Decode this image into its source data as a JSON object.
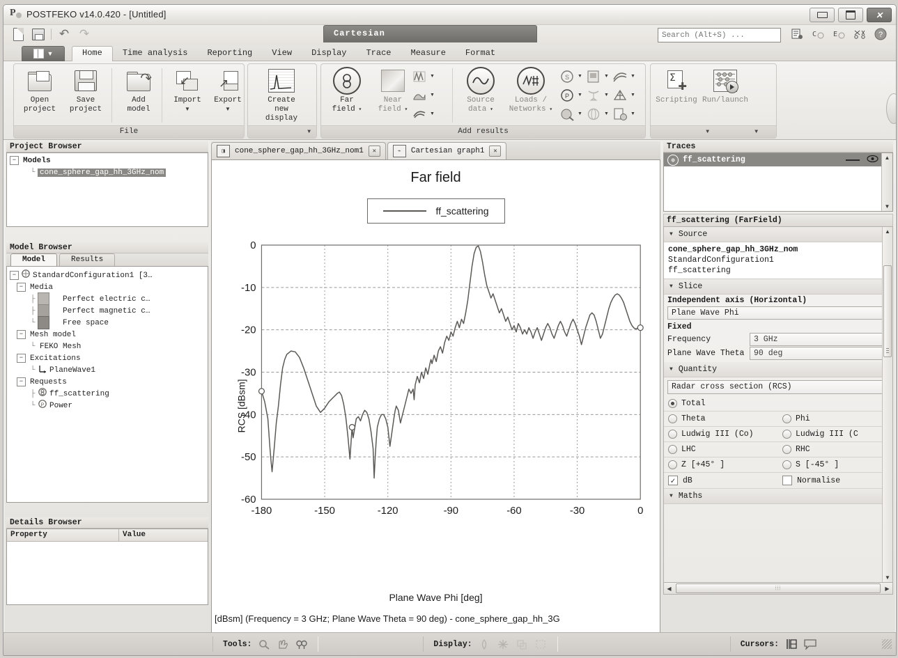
{
  "window": {
    "title": "POSTFEKO v14.0.420 - [Untitled]",
    "app_icon": "postfeko-icon",
    "minimize": "minimize-icon",
    "maximize": "maximize-icon",
    "close": "close-icon"
  },
  "quick_access": {
    "new_label": "new-document-icon",
    "save_label": "save-icon",
    "undo_label": "undo-icon",
    "redo_label": "redo-icon"
  },
  "search": {
    "placeholder": "Search (Alt+S) ...",
    "value": ""
  },
  "help_icons": [
    "notes-icon",
    "cadfeko-icon",
    "editfeko-icon",
    "feko-icon",
    "help-icon"
  ],
  "ribbon": {
    "contextual_group": "Cartesian",
    "app_menu": "application-menu",
    "tabs": [
      {
        "label": "Home",
        "active": true
      },
      {
        "label": "Time analysis",
        "active": false
      },
      {
        "label": "Reporting",
        "active": false
      },
      {
        "label": "View",
        "active": false
      },
      {
        "label": "Display",
        "active": false
      },
      {
        "label": "Trace",
        "active": false
      },
      {
        "label": "Measure",
        "active": false
      },
      {
        "label": "Format",
        "active": false
      }
    ],
    "groups": [
      {
        "caption": "File",
        "buttons": [
          {
            "label1": "Open",
            "label2": "project",
            "icon": "open-project-icon",
            "dropdown": false
          },
          {
            "label1": "Save",
            "label2": "project",
            "icon": "save-project-icon",
            "dropdown": false
          },
          {
            "label1": "Add",
            "label2": "model",
            "icon": "add-model-icon",
            "dropdown": true
          },
          {
            "label1": "Import",
            "label2": "",
            "icon": "import-icon",
            "dropdown": true
          },
          {
            "label1": "Export",
            "label2": "",
            "icon": "export-icon",
            "dropdown": true
          }
        ]
      },
      {
        "caption": "",
        "buttons": [
          {
            "label1": "Create",
            "label2": "new display",
            "icon": "create-new-display-icon",
            "dropdown": false
          }
        ]
      },
      {
        "caption": "Add results",
        "buttons": [
          {
            "label1": "Far",
            "label2": "field",
            "icon": "far-field-icon",
            "dropdown": true
          },
          {
            "label1": "Near",
            "label2": "field",
            "icon": "near-field-icon",
            "dropdown": true,
            "disabled": true
          },
          {
            "label1": "Source",
            "label2": "data",
            "icon": "source-data-icon",
            "dropdown": true,
            "disabled": true
          },
          {
            "label1": "Loads /",
            "label2": "Networks",
            "icon": "loads-networks-icon",
            "dropdown": true,
            "disabled": true
          }
        ],
        "small_icons": [
          "currents-icon",
          "surface-graph-icon",
          "ray-icon",
          "sparam-icon",
          "report-icon",
          "optimisation-icon",
          "power-icon",
          "antenna-icon",
          "mesh-icon",
          "error-estimate-icon",
          "sphere-icon",
          "import-data-icon"
        ]
      },
      {
        "caption": "",
        "buttons": [
          {
            "label1": "Scripting",
            "label2": "",
            "icon": "scripting-icon",
            "dropdown": true
          },
          {
            "label1": "Run/launch",
            "label2": "",
            "icon": "run-launch-icon",
            "dropdown": true
          }
        ]
      }
    ]
  },
  "project_browser": {
    "title": "Project Browser",
    "root": "Models",
    "selected_model": "cone_sphere_gap_hh_3GHz_nom"
  },
  "model_browser": {
    "title": "Model Browser",
    "tabs": [
      {
        "label": "Model",
        "active": true
      },
      {
        "label": "Results",
        "active": false
      }
    ],
    "tree": [
      {
        "label": "StandardConfiguration1 [3…",
        "indent": 0,
        "expander": "-",
        "icon": "configuration-icon"
      },
      {
        "label": "Media",
        "indent": 1,
        "expander": "-",
        "icon": ""
      },
      {
        "label": "Perfect electric c…",
        "indent": 2,
        "expander": "",
        "icon": "swatch-light"
      },
      {
        "label": "Perfect magnetic c…",
        "indent": 2,
        "expander": "",
        "icon": "swatch-mid"
      },
      {
        "label": "Free space",
        "indent": 2,
        "expander": "",
        "icon": "swatch-dark"
      },
      {
        "label": "Mesh model",
        "indent": 1,
        "expander": "-",
        "icon": ""
      },
      {
        "label": "FEKO Mesh",
        "indent": 2,
        "expander": "",
        "icon": ""
      },
      {
        "label": "Excitations",
        "indent": 1,
        "expander": "-",
        "icon": ""
      },
      {
        "label": "PlaneWave1",
        "indent": 2,
        "expander": "",
        "icon": "axes-icon"
      },
      {
        "label": "Requests",
        "indent": 1,
        "expander": "-",
        "icon": ""
      },
      {
        "label": "ff_scattering",
        "indent": 2,
        "expander": "",
        "icon": "farfield-request-icon"
      },
      {
        "label": "Power",
        "indent": 2,
        "expander": "",
        "icon": "power-request-icon"
      }
    ]
  },
  "details_browser": {
    "title": "Details Browser",
    "columns": [
      "Property",
      "Value"
    ],
    "rows": []
  },
  "document_tabs": [
    {
      "label": "cone_sphere_gap_hh_3GHz_nom1",
      "icon": "model-view-icon",
      "active": false,
      "close": "close-icon"
    },
    {
      "label": "Cartesian graph1",
      "icon": "cartesian-graph-icon",
      "active": true,
      "close": "close-icon"
    }
  ],
  "chart_data": {
    "type": "line",
    "title": "Far field",
    "xlabel": "Plane Wave Phi [deg]",
    "ylabel": "RCS [dBsm]",
    "caption": "[dBsm] (Frequency = 3 GHz; Plane Wave Theta = 90 deg) - cone_sphere_gap_hh_3G",
    "legend": [
      {
        "name": "ff_scattering",
        "color": "#5b5956"
      }
    ],
    "legend_position": "top-center",
    "grid": true,
    "xlim": [
      -180,
      0
    ],
    "ylim": [
      -60,
      0
    ],
    "xticks": [
      -180,
      -150,
      -120,
      -90,
      -60,
      -30,
      0
    ],
    "yticks": [
      0,
      -10,
      -20,
      -30,
      -40,
      -50,
      -60
    ],
    "markers": [
      {
        "x": -180,
        "y": -34.5
      },
      {
        "x": -137,
        "y": -43.0
      },
      {
        "x": 0,
        "y": -19.5
      }
    ],
    "series": [
      {
        "name": "ff_scattering",
        "x": [
          -180,
          -178.5,
          -177,
          -176,
          -175.5,
          -175,
          -174,
          -173,
          -172,
          -171,
          -170,
          -169,
          -168,
          -166,
          -164,
          -162,
          -160,
          -158,
          -156,
          -154,
          -152,
          -150,
          -148,
          -146,
          -144,
          -143,
          -142,
          -141,
          -140,
          -139,
          -138,
          -137,
          -136.5,
          -136,
          -135.5,
          -135,
          -134,
          -133,
          -132,
          -131,
          -130,
          -129,
          -128,
          -127,
          -126.5,
          -126,
          -125.5,
          -125,
          -124,
          -123,
          -122,
          -121,
          -120,
          -119,
          -118,
          -117,
          -116.5,
          -116,
          -115,
          -114,
          -113,
          -112,
          -111,
          -110,
          -109,
          -108,
          -107.5,
          -107,
          -106,
          -105,
          -104,
          -103,
          -102,
          -101,
          -100,
          -99.5,
          -99,
          -98,
          -97,
          -96,
          -95,
          -94,
          -93,
          -92,
          -91,
          -90,
          -89,
          -88,
          -87,
          -86,
          -85,
          -84,
          -83,
          -82,
          -81,
          -80,
          -79,
          -78,
          -77,
          -76,
          -75,
          -74,
          -73,
          -72,
          -71,
          -70,
          -69,
          -68,
          -67,
          -66,
          -65,
          -64,
          -63,
          -62,
          -61,
          -60,
          -59,
          -58,
          -57,
          -56,
          -55,
          -54,
          -53,
          -52,
          -51,
          -50,
          -49,
          -48,
          -47,
          -46,
          -45,
          -44,
          -43,
          -42,
          -41,
          -40,
          -39,
          -38,
          -37,
          -36,
          -35,
          -34,
          -33,
          -32,
          -31,
          -30,
          -29,
          -28,
          -27,
          -26,
          -25,
          -24,
          -23,
          -22,
          -21,
          -20,
          -19,
          -18,
          -17,
          -16,
          -15,
          -14,
          -13,
          -12,
          -11,
          -10,
          -9,
          -8,
          -7,
          -6,
          -5,
          -4,
          -3,
          -2,
          -1,
          0
        ],
        "y": [
          -34.5,
          -37.0,
          -41.0,
          -48.0,
          -51.0,
          -53.5,
          -48.0,
          -42.0,
          -38.0,
          -33.0,
          -29.0,
          -27.0,
          -25.8,
          -25.0,
          -25.2,
          -26.5,
          -29.0,
          -32.0,
          -35.0,
          -38.0,
          -39.5,
          -38.5,
          -37.0,
          -36.0,
          -35.0,
          -34.7,
          -35.5,
          -37.5,
          -40.5,
          -45.0,
          -50.5,
          -43.0,
          -45.5,
          -44.0,
          -42.5,
          -41.0,
          -40.5,
          -41.5,
          -40.0,
          -39.0,
          -39.5,
          -41.0,
          -44.0,
          -48.0,
          -55.0,
          -50.0,
          -46.0,
          -43.0,
          -41.0,
          -40.0,
          -40.0,
          -41.0,
          -43.0,
          -47.5,
          -44.0,
          -40.5,
          -39.0,
          -38.0,
          -39.0,
          -42.0,
          -40.0,
          -38.0,
          -36.0,
          -34.0,
          -35.0,
          -34.0,
          -36.5,
          -33.0,
          -31.0,
          -32.5,
          -30.0,
          -31.5,
          -29.0,
          -30.5,
          -28.0,
          -27.0,
          -28.0,
          -26.0,
          -27.5,
          -25.0,
          -24.0,
          -25.5,
          -23.0,
          -21.5,
          -22.5,
          -20.5,
          -21.5,
          -19.5,
          -18.0,
          -19.5,
          -17.5,
          -18.5,
          -16.0,
          -13.0,
          -9.0,
          -5.0,
          -2.0,
          -0.5,
          -0.2,
          -1.5,
          -4.0,
          -7.0,
          -9.5,
          -11.0,
          -12.5,
          -11.5,
          -13.0,
          -14.5,
          -16.0,
          -15.0,
          -16.5,
          -18.0,
          -17.0,
          -18.5,
          -20.0,
          -19.0,
          -20.5,
          -18.5,
          -19.5,
          -21.0,
          -20.0,
          -21.0,
          -19.5,
          -20.5,
          -22.0,
          -20.5,
          -19.5,
          -21.0,
          -22.5,
          -21.0,
          -19.5,
          -18.5,
          -19.5,
          -21.0,
          -22.0,
          -20.5,
          -19.0,
          -18.0,
          -19.0,
          -20.5,
          -21.5,
          -20.0,
          -18.5,
          -17.5,
          -18.5,
          -20.0,
          -21.5,
          -23.5,
          -21.5,
          -19.5,
          -18.0,
          -16.5,
          -16.0,
          -16.5,
          -18.0,
          -20.0,
          -22.0,
          -21.0,
          -19.0,
          -17.0,
          -15.0,
          -13.5,
          -12.5,
          -11.8,
          -11.5,
          -11.8,
          -12.5,
          -13.5,
          -15.0,
          -16.5,
          -18.0,
          -19.0,
          -19.6,
          -19.8,
          -19.5
        ]
      }
    ]
  },
  "traces_panel": {
    "title": "Traces",
    "items": [
      {
        "label": "ff_scattering",
        "icon": "farfield-trace-icon",
        "selected": true
      }
    ],
    "line_style_icon": "line-style-icon",
    "visibility_icon": "eye-icon"
  },
  "properties_panel": {
    "header": "ff_scattering (FarField)",
    "source": {
      "group_label": "Source",
      "lines": [
        "cone_sphere_gap_hh_3GHz_nom",
        "StandardConfiguration1",
        "ff_scattering"
      ]
    },
    "slice": {
      "group_label": "Slice",
      "independent_axis_label": "Independent axis (Horizontal)",
      "independent_axis_value": "Plane Wave Phi",
      "fixed_label": "Fixed",
      "fixed": [
        {
          "name": "Frequency",
          "value": "3 GHz"
        },
        {
          "name": "Plane Wave Theta",
          "value": "90 deg"
        }
      ]
    },
    "quantity": {
      "group_label": "Quantity",
      "value": "Radar cross section (RCS)",
      "radios": [
        [
          {
            "label": "Total",
            "selected": true
          }
        ],
        [
          {
            "label": "Theta",
            "selected": false
          },
          {
            "label": "Phi",
            "selected": false
          }
        ],
        [
          {
            "label": "Ludwig III (Co)",
            "selected": false
          },
          {
            "label": "Ludwig III (C",
            "selected": false
          }
        ],
        [
          {
            "label": "LHC",
            "selected": false
          },
          {
            "label": "RHC",
            "selected": false
          }
        ],
        [
          {
            "label": "Z [+45° ]",
            "selected": false
          },
          {
            "label": "S [-45° ]",
            "selected": false
          }
        ]
      ],
      "checks": [
        {
          "label": "dB",
          "checked": true
        },
        {
          "label": "Normalise",
          "checked": false
        }
      ]
    },
    "maths": {
      "group_label": "Maths"
    }
  },
  "status_bar": {
    "sections": [
      {
        "label": "Tools:",
        "icons": [
          "zoom-icon",
          "pan-icon",
          "find-icon"
        ]
      },
      {
        "label": "Display:",
        "icons": [
          "rotate-icon",
          "move-icon",
          "scale-icon",
          "select-icon"
        ]
      },
      {
        "label": "Cursors:",
        "icons": [
          "cursor-icon",
          "annotation-icon"
        ]
      }
    ],
    "resize_grip": "resize-grip-icon"
  }
}
